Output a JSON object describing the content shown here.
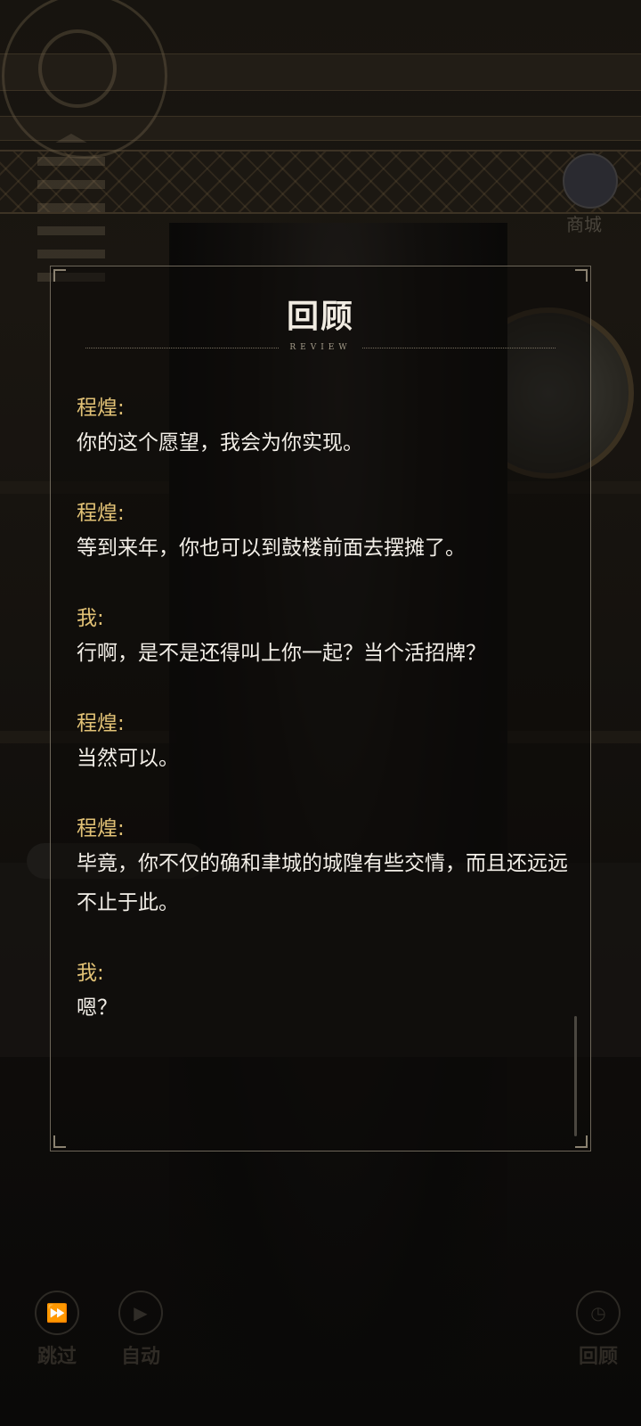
{
  "review": {
    "title": "回顾",
    "subtitle": "REVIEW",
    "entries": [
      {
        "speaker": "程煌:",
        "text": "你的这个愿望，我会为你实现。"
      },
      {
        "speaker": "程煌:",
        "text": "等到来年，你也可以到鼓楼前面去摆摊了。"
      },
      {
        "speaker": "我:",
        "text": "行啊，是不是还得叫上你一起？当个活招牌？"
      },
      {
        "speaker": "程煌:",
        "text": "当然可以。"
      },
      {
        "speaker": "程煌:",
        "text": "毕竟，你不仅的确和聿城的城隍有些交情，而且还远远不止于此。"
      },
      {
        "speaker": "我:",
        "text": "嗯？"
      }
    ]
  },
  "controls": {
    "skip_label": "跳过",
    "auto_label": "自动",
    "review_label": "回顾"
  },
  "shop_label": "商城",
  "colors": {
    "speaker": "#e2c276",
    "text": "#f3efe8",
    "panel_border": "#6d6659"
  }
}
